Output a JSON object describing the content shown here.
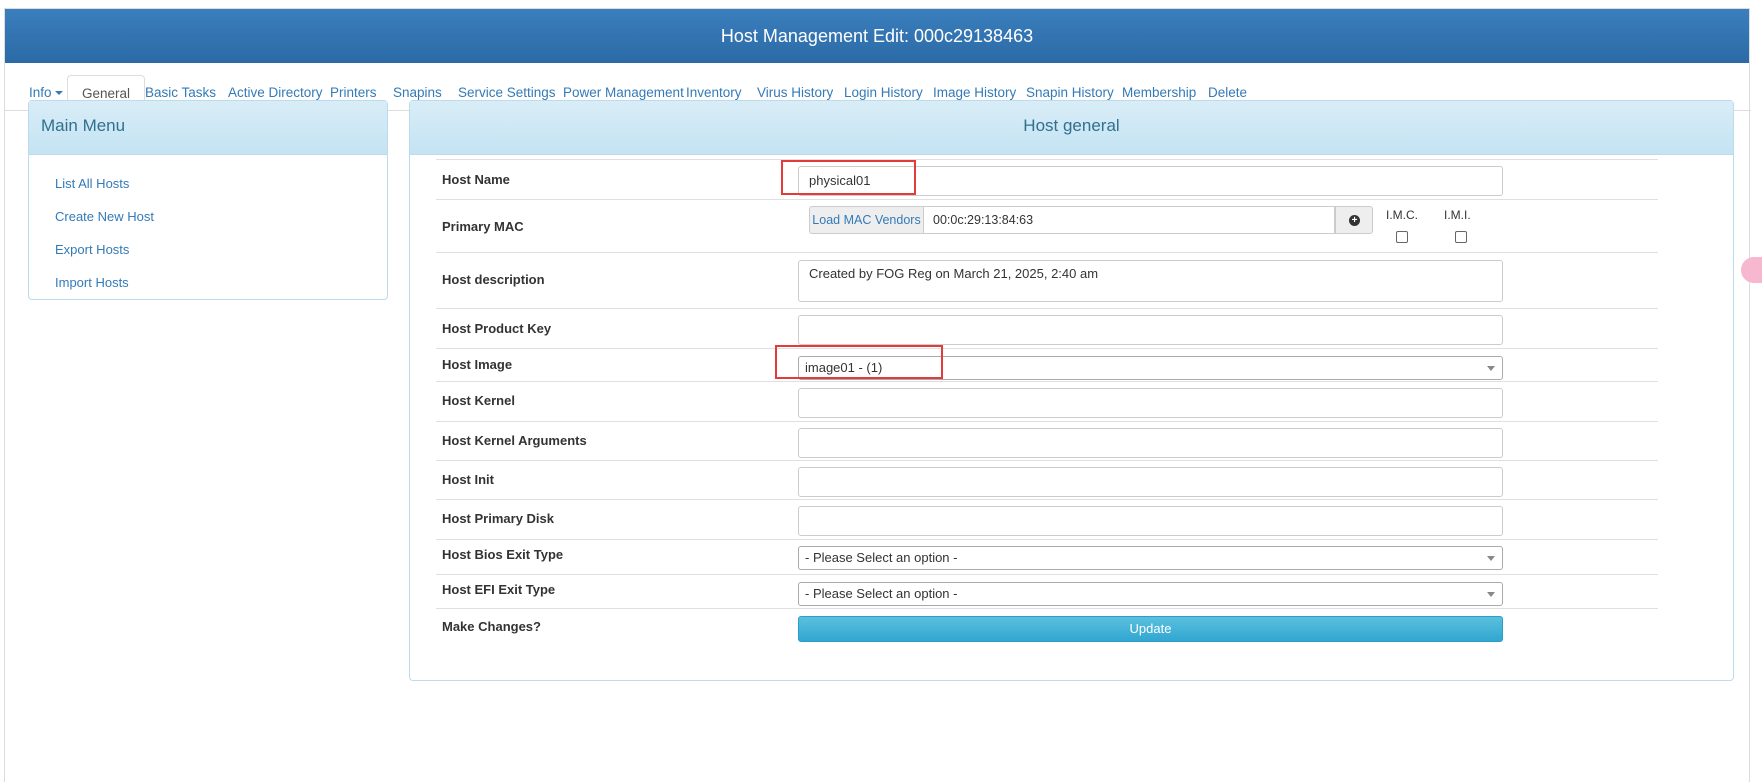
{
  "header": {
    "title": "Host Management Edit: 000c29138463"
  },
  "tabs": [
    {
      "label": "Info"
    },
    {
      "label": "General"
    },
    {
      "label": "Basic Tasks"
    },
    {
      "label": "Active Directory"
    },
    {
      "label": "Printers"
    },
    {
      "label": "Snapins"
    },
    {
      "label": "Service Settings"
    },
    {
      "label": "Power Management"
    },
    {
      "label": "Inventory"
    },
    {
      "label": "Virus History"
    },
    {
      "label": "Login History"
    },
    {
      "label": "Image History"
    },
    {
      "label": "Snapin History"
    },
    {
      "label": "Membership"
    },
    {
      "label": "Delete"
    }
  ],
  "main_menu": {
    "title": "Main Menu",
    "items": [
      "List All Hosts",
      "Create New Host",
      "Export Hosts",
      "Import Hosts"
    ]
  },
  "host_general": {
    "title": "Host general",
    "host_name": {
      "label": "Host Name",
      "value": "physical01"
    },
    "primary_mac": {
      "label": "Primary MAC",
      "load_vendors_button": "Load MAC Vendors",
      "value": "00:0c:29:13:84:63",
      "imc_label": "I.M.C.",
      "imi_label": "I.M.I."
    },
    "description": {
      "label": "Host description",
      "value": "Created by FOG Reg on March 21, 2025, 2:40 am"
    },
    "product_key": {
      "label": "Host Product Key",
      "value": ""
    },
    "image": {
      "label": "Host Image",
      "value": "image01 - (1)"
    },
    "kernel": {
      "label": "Host Kernel",
      "value": ""
    },
    "kernel_args": {
      "label": "Host Kernel Arguments",
      "value": ""
    },
    "init": {
      "label": "Host Init",
      "value": ""
    },
    "primary_disk": {
      "label": "Host Primary Disk",
      "value": ""
    },
    "bios_exit": {
      "label": "Host Bios Exit Type",
      "value": "- Please Select an option -"
    },
    "efi_exit": {
      "label": "Host EFI Exit Type",
      "value": "- Please Select an option -"
    },
    "make_changes": {
      "label": "Make Changes?",
      "button": "Update"
    }
  },
  "colors": {
    "header_blue": "#2f71ad",
    "link_blue": "#337ab7",
    "panel_head": "#d9edf7",
    "update_button": "#34aad6",
    "highlight_red": "#e23b3b"
  }
}
